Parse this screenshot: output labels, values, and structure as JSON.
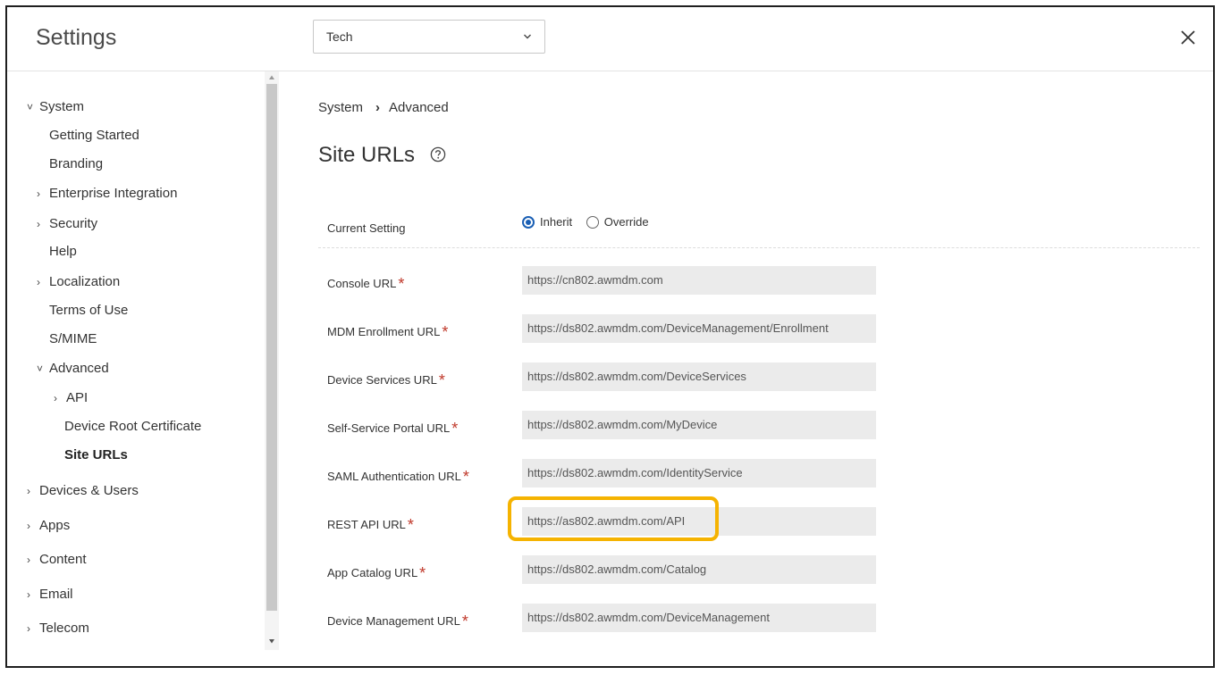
{
  "header": {
    "title": "Settings",
    "org_selected": "Tech"
  },
  "sidebar": {
    "items": [
      {
        "label": "System",
        "caret": "˅"
      },
      {
        "label": "Getting Started",
        "caret": ""
      },
      {
        "label": "Branding",
        "caret": ""
      },
      {
        "label": "Enterprise Integration",
        "caret": "›"
      },
      {
        "label": "Security",
        "caret": "›"
      },
      {
        "label": "Help",
        "caret": ""
      },
      {
        "label": "Localization",
        "caret": "›"
      },
      {
        "label": "Terms of Use",
        "caret": ""
      },
      {
        "label": "S/MIME",
        "caret": ""
      },
      {
        "label": "Advanced",
        "caret": "˅"
      },
      {
        "label": "API",
        "caret": "›"
      },
      {
        "label": "Device Root Certificate",
        "caret": ""
      },
      {
        "label": "Site URLs",
        "caret": ""
      },
      {
        "label": "Devices & Users",
        "caret": "›"
      },
      {
        "label": "Apps",
        "caret": "›"
      },
      {
        "label": "Content",
        "caret": "›"
      },
      {
        "label": "Email",
        "caret": "›"
      },
      {
        "label": "Telecom",
        "caret": "›"
      }
    ]
  },
  "main": {
    "breadcrumb": {
      "root": "System",
      "separator": "›",
      "current": "Advanced"
    },
    "page_title": "Site URLs",
    "current_setting": {
      "label": "Current Setting",
      "options": [
        "Inherit",
        "Override"
      ],
      "selected": "Inherit"
    },
    "required_mark": "*",
    "fields": [
      {
        "label": "Console URL",
        "value": "https://cn802.awmdm.com"
      },
      {
        "label": "MDM Enrollment URL",
        "value": "https://ds802.awmdm.com/DeviceManagement/Enrollment"
      },
      {
        "label": "Device Services URL",
        "value": "https://ds802.awmdm.com/DeviceServices"
      },
      {
        "label": "Self-Service Portal URL",
        "value": "https://ds802.awmdm.com/MyDevice"
      },
      {
        "label": "SAML Authentication URL",
        "value": "https://ds802.awmdm.com/IdentityService"
      },
      {
        "label": "REST API URL",
        "value": "https://as802.awmdm.com/API"
      },
      {
        "label": "App Catalog URL",
        "value": "https://ds802.awmdm.com/Catalog"
      },
      {
        "label": "Device Management URL",
        "value": "https://ds802.awmdm.com/DeviceManagement"
      }
    ]
  },
  "colors": {
    "accent": "#1a5fb4",
    "required": "#c0392b",
    "highlight": "#f5b301",
    "field_bg": "#ebebeb"
  }
}
